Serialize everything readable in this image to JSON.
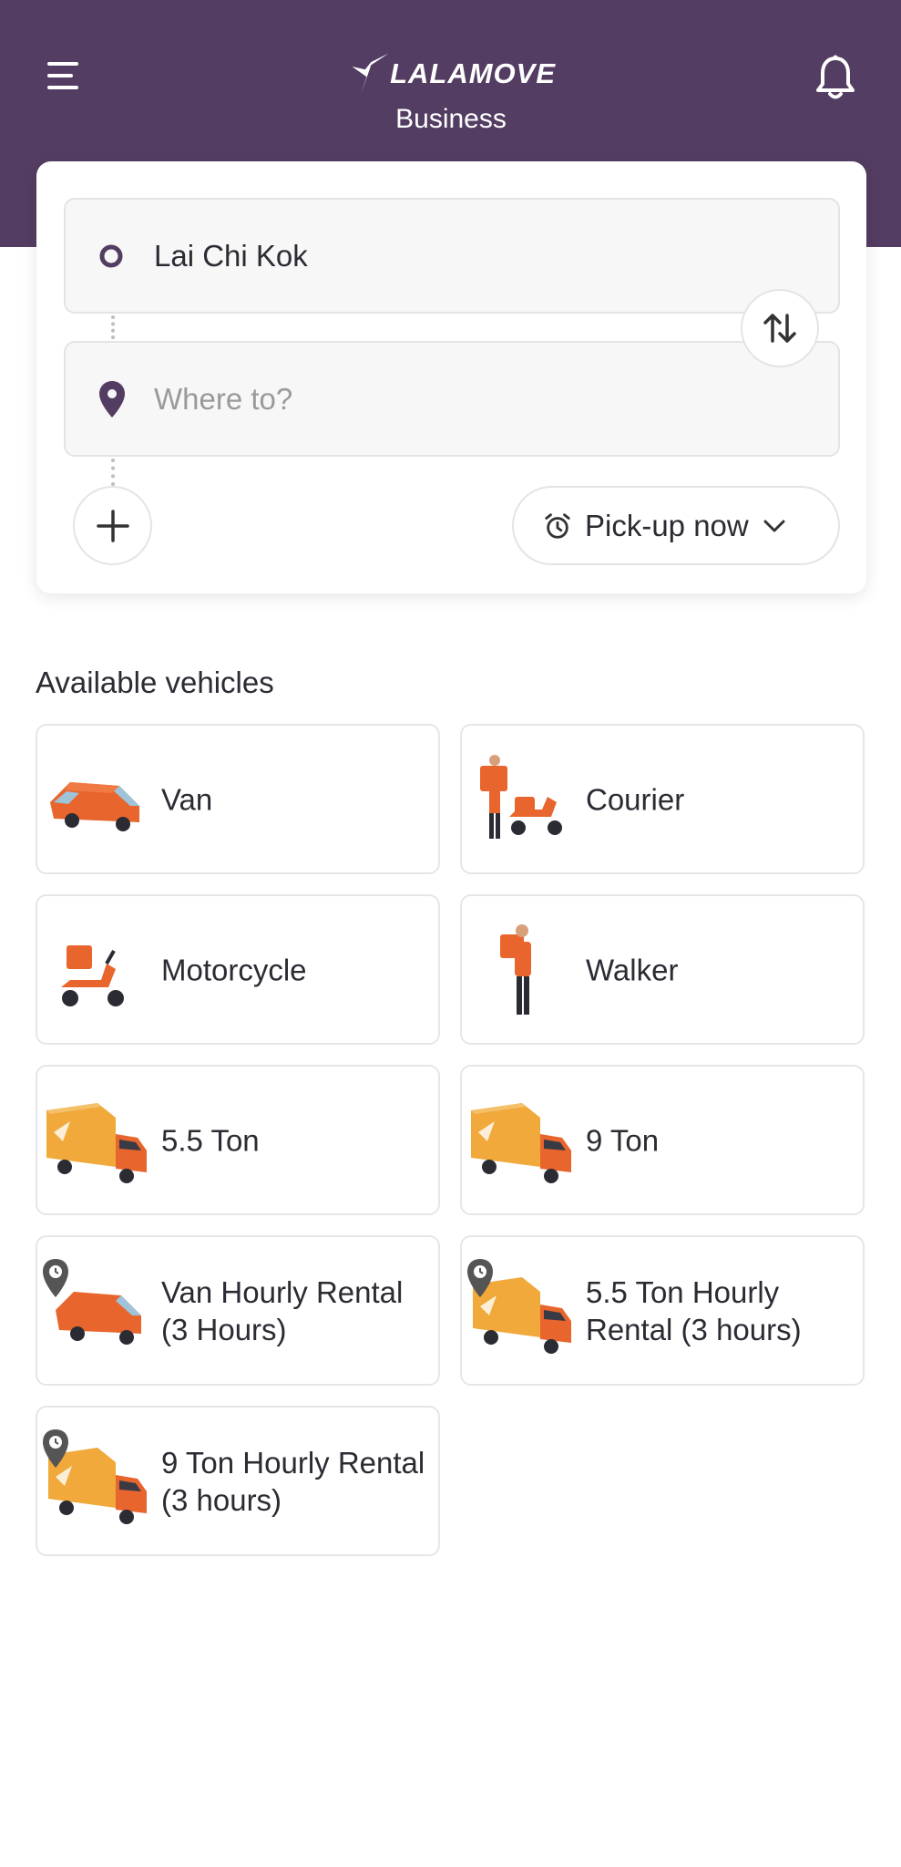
{
  "header": {
    "brand_name": "LALAMOVE",
    "brand_sub": "Business",
    "menu_icon": "hamburger-menu-icon",
    "bell_icon": "bell-icon",
    "background_color": "#533d62"
  },
  "route": {
    "pickup_value": "Lai Chi Kok",
    "dropoff_placeholder": "Where to?",
    "pickup_time_label": "Pick-up now",
    "swap_icon": "swap-arrows-icon",
    "add_stop_icon": "plus-icon",
    "alarm_icon": "alarm-clock-icon"
  },
  "vehicles_section": {
    "title": "Available vehicles",
    "items": [
      {
        "label": "Van",
        "icon": "van-icon"
      },
      {
        "label": "Courier",
        "icon": "courier-scooter-icon"
      },
      {
        "label": "Motorcycle",
        "icon": "motorcycle-icon"
      },
      {
        "label": "Walker",
        "icon": "walker-icon"
      },
      {
        "label": "5.5 Ton",
        "icon": "truck-icon"
      },
      {
        "label": "9 Ton",
        "icon": "truck-icon"
      },
      {
        "label": "Van Hourly Rental (3 Hours)",
        "icon": "van-hourly-icon"
      },
      {
        "label": "5.5 Ton Hourly Rental (3 hours)",
        "icon": "truck-hourly-icon"
      },
      {
        "label": "9 Ton Hourly Rental (3 hours)",
        "icon": "truck-hourly-icon"
      }
    ]
  },
  "colors": {
    "accent": "#533d62",
    "vehicle_orange": "#e8652d",
    "truck_yellow": "#f0a93a"
  }
}
